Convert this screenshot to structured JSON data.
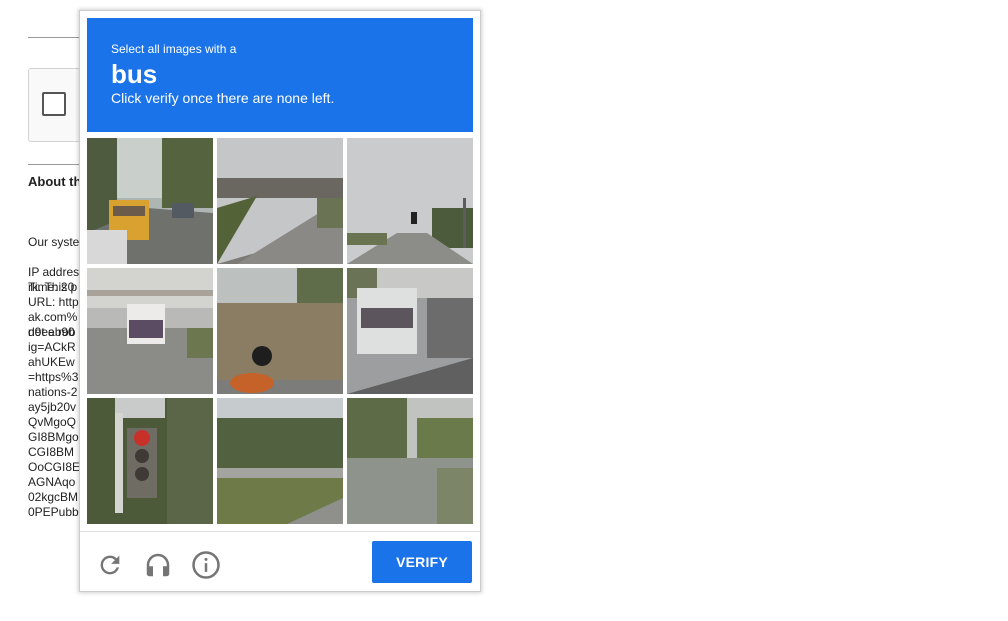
{
  "background_page": {
    "heading": "About th",
    "paragraph_lines": [
      "Our syste",
      "rk. This p",
      "not a rob"
    ],
    "details_lines": [
      "IP addres",
      "Time: 20",
      "URL: http",
      "ak.com%",
      "d9eeb90",
      "ig=ACkR",
      "ahUKEw",
      "=https%3",
      "nations-2",
      "ay5jb20v",
      "QvMgoQ",
      "GI8BMgo",
      "CGI8BM",
      "OoCGI8E",
      "AGNAqo",
      "02kgcBM",
      "0PEPubb"
    ]
  },
  "challenge": {
    "instruction": "Select all images with a",
    "target": "bus",
    "subtext": "Click verify once there are none left.",
    "tiles": [
      {
        "subject": "street with school bus"
      },
      {
        "subject": "highway overpass"
      },
      {
        "subject": "road with traffic light"
      },
      {
        "subject": "bus on highway"
      },
      {
        "subject": "motorcycle by wall"
      },
      {
        "subject": "bus at stop"
      },
      {
        "subject": "traffic light"
      },
      {
        "subject": "trees by road"
      },
      {
        "subject": "palm trees and fence"
      }
    ],
    "verify_label": "VERIFY",
    "icons": {
      "reload": "reload-icon",
      "audio": "headphones-icon",
      "info": "info-icon"
    },
    "colors": {
      "accent": "#1a73e8",
      "icon": "#757575"
    }
  }
}
